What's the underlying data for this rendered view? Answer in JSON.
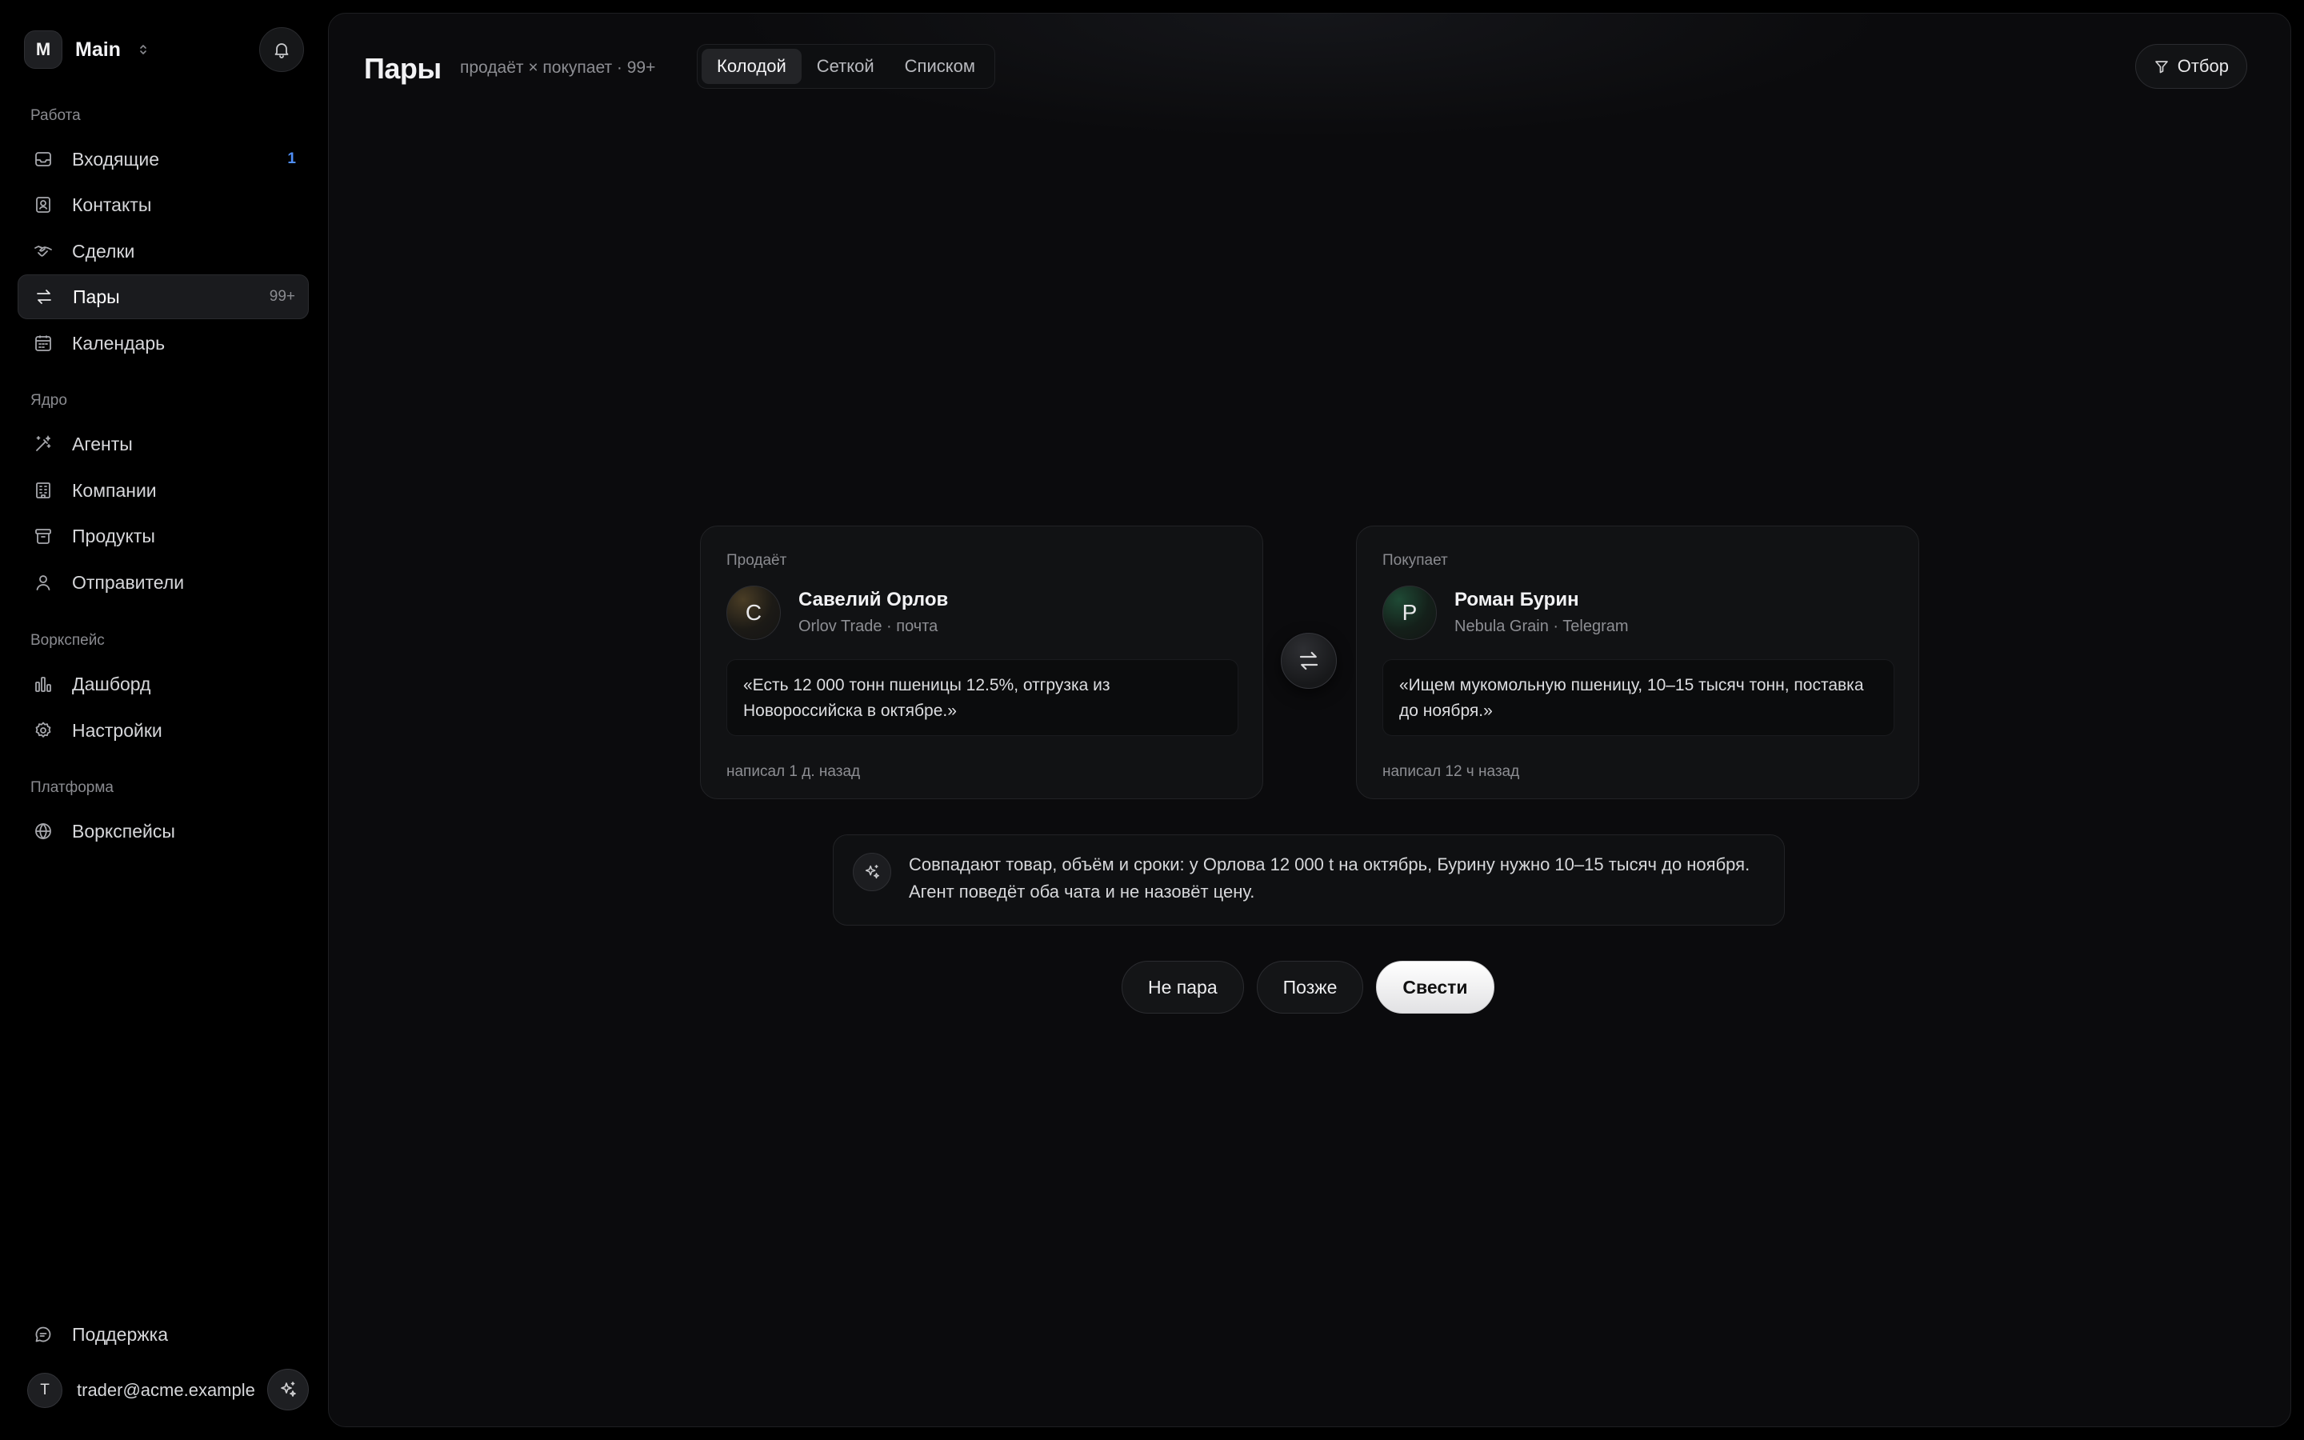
{
  "workspace": {
    "logo_letter": "M",
    "name": "Main"
  },
  "sidebar": {
    "sections": [
      {
        "label": "Работа"
      },
      {
        "label": "Ядро"
      },
      {
        "label": "Воркспейс"
      },
      {
        "label": "Платформа"
      }
    ],
    "items": [
      {
        "label": "Входящие",
        "icon": "inbox-icon",
        "badge": "1"
      },
      {
        "label": "Контакты",
        "icon": "contacts-icon"
      },
      {
        "label": "Сделки",
        "icon": "handshake-icon"
      },
      {
        "label": "Пары",
        "icon": "swap-icon",
        "badge": "99+",
        "active": true
      },
      {
        "label": "Календарь",
        "icon": "calendar-icon"
      },
      {
        "label": "Агенты",
        "icon": "wand-icon"
      },
      {
        "label": "Компании",
        "icon": "building-icon"
      },
      {
        "label": "Продукты",
        "icon": "archive-icon"
      },
      {
        "label": "Отправители",
        "icon": "user-icon"
      },
      {
        "label": "Дашборд",
        "icon": "bar-chart-icon"
      },
      {
        "label": "Настройки",
        "icon": "gear-icon"
      },
      {
        "label": "Воркспейсы",
        "icon": "globe-icon"
      }
    ],
    "support_label": "Поддержка",
    "user": {
      "avatar_letter": "T",
      "email": "trader@acme.example"
    }
  },
  "header": {
    "title": "Пары",
    "subtitle": "продаёт × покупает · 99+",
    "tabs": [
      {
        "label": "Колодой",
        "active": true
      },
      {
        "label": "Сеткой"
      },
      {
        "label": "Списком"
      }
    ],
    "filter_label": "Отбор"
  },
  "pair": {
    "seller": {
      "role": "Продаёт",
      "avatar_letter": "С",
      "name": "Савелий Орлов",
      "meta": "Orlov Trade · почта",
      "quote": "«Есть 12 000 тонн пшеницы 12.5%, отгрузка из Новороссийска в октябре.»",
      "time": "написал 1 д. назад"
    },
    "buyer": {
      "role": "Покупает",
      "avatar_letter": "Р",
      "name": "Роман Бурин",
      "meta": "Nebula Grain · Telegram",
      "quote": "«Ищем мукомольную пшеницу, 10–15 тысяч тонн, поставка до ноября.»",
      "time": "написал 12 ч назад"
    },
    "reason": "Совпадают товар, объём и сроки: у Орлова 12 000 t на октябрь, Бурину нужно 10–15 тысяч до ноября. Агент поведёт оба чата и не назовёт цену."
  },
  "actions": {
    "reject_label": "Не пара",
    "later_label": "Позже",
    "match_label": "Свести"
  },
  "colors": {
    "accent_badge": "#4f8ef7",
    "background": "#000000",
    "panel": "#0b0b0d"
  }
}
